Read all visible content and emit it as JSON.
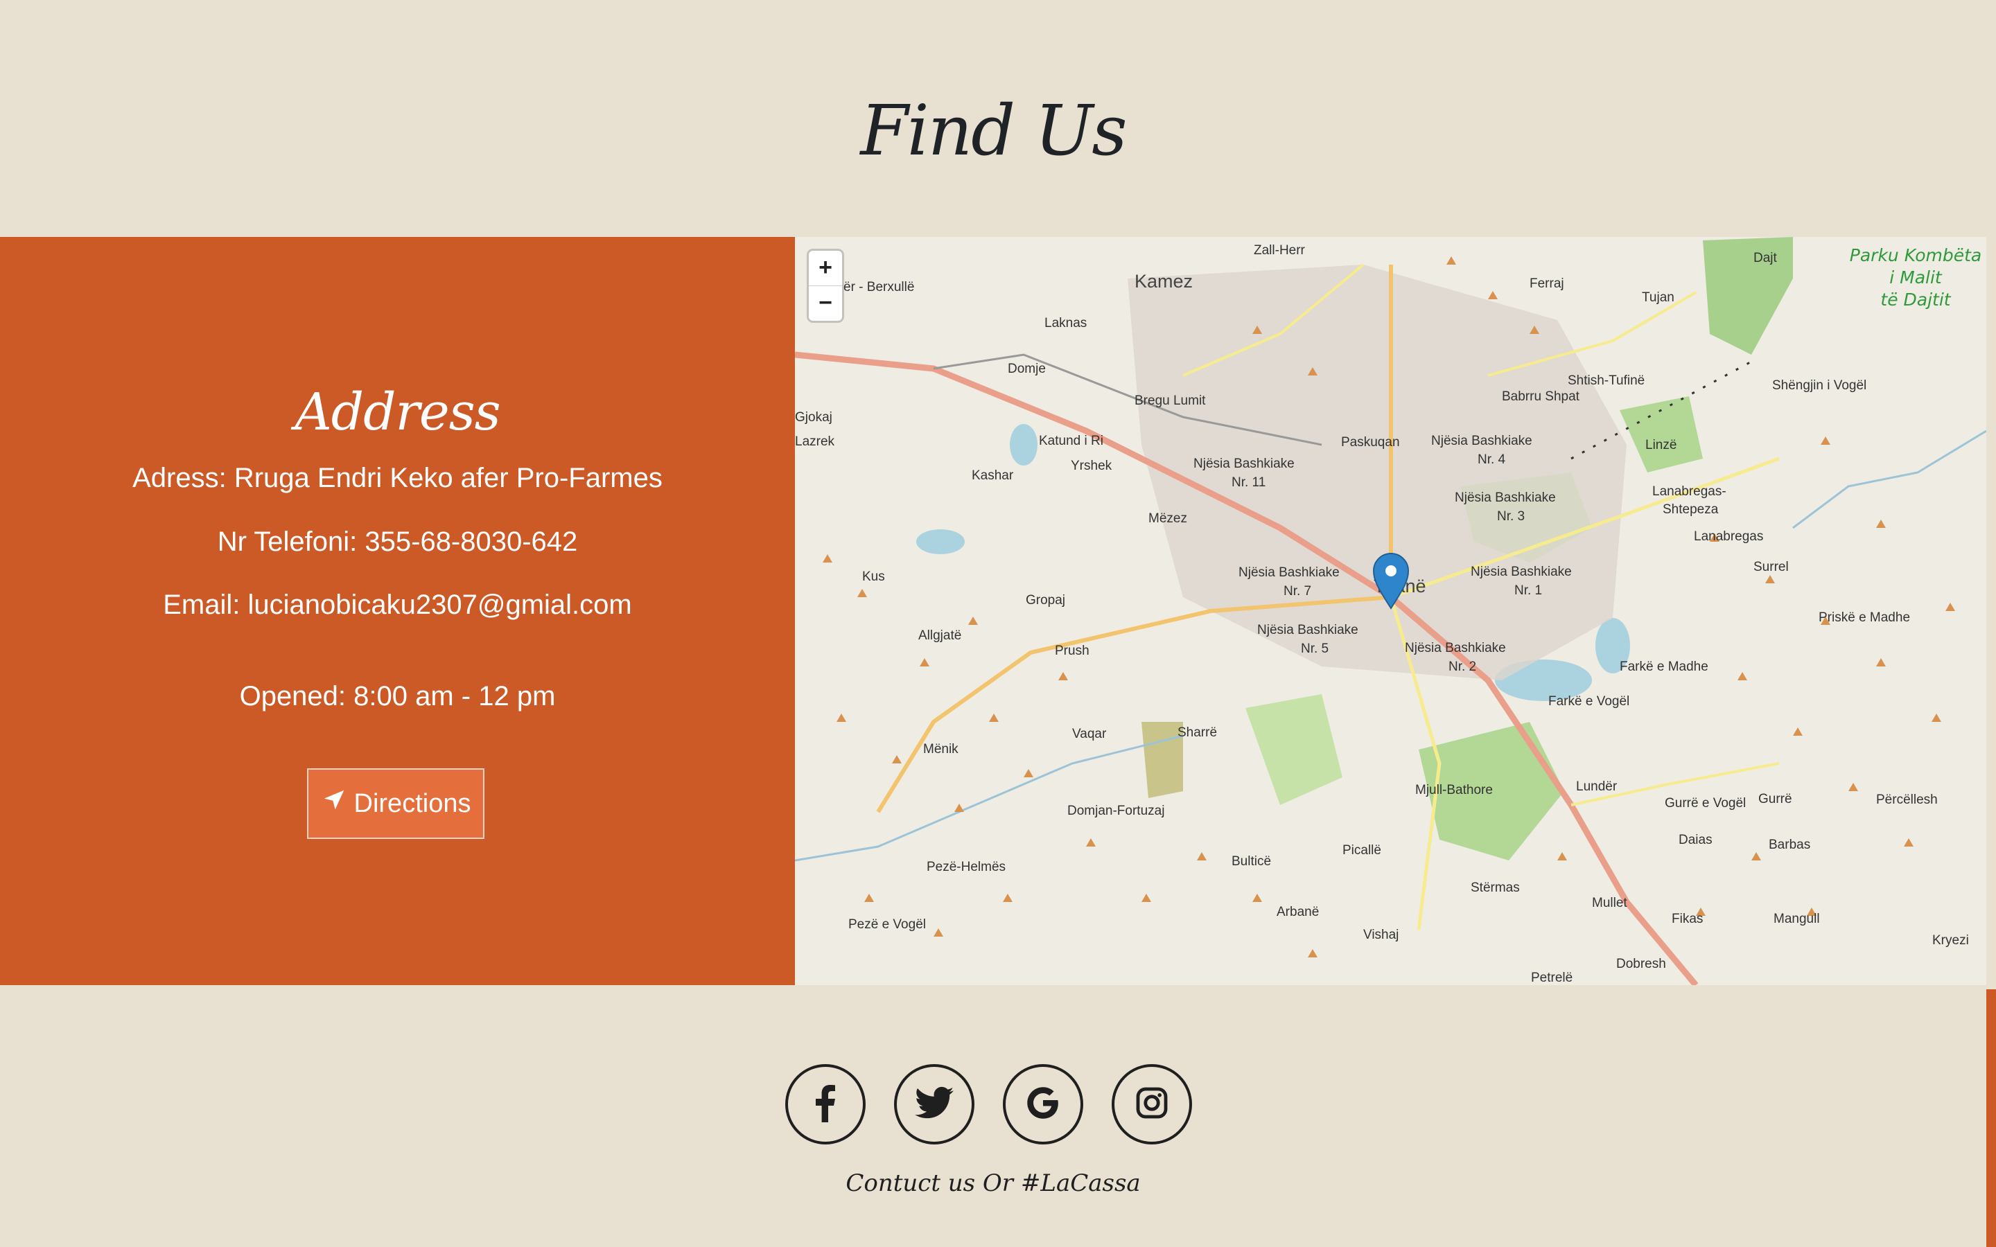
{
  "section_title": "Find Us",
  "address": {
    "heading": "Address",
    "address_line": "Adress: Rruga Endri Keko afer Pro-Farmes",
    "phone_line": "Nr Telefoni: 355-68-8030-642",
    "email_line": "Email: lucianobicaku2307@gmial.com",
    "hours_line": "Opened: 8:00 am - 12 pm",
    "directions_label": "Directions",
    "directions_icon": "location-arrow-icon"
  },
  "map": {
    "zoom_in": "+",
    "zoom_out": "−",
    "marker_icon": "map-pin-icon",
    "park_label": [
      "Parku Kombëta",
      "i Malit",
      "të Dajtit"
    ],
    "labels": [
      "Zall-Herr",
      "Kamez",
      "Ferraj",
      "Tujan",
      "Dajt",
      "Laknas",
      "Bregu Lumit",
      "Domje",
      "Shtish-Tufinë",
      "Shëngjin i Vogël",
      "Babrru Shpat",
      "Paskuqan",
      "Katund i Ri",
      "Yrshek",
      "Njësia Bashkiake Nr. 11",
      "Njësia Bashkiake Nr. 4",
      "Linzë",
      "Kashar",
      "Mëzez",
      "Njësia Bashkiake Nr. 3",
      "Lanabregas-Shtepeza",
      "Lanabregas",
      "Kus",
      "Gropaj",
      "Njësia Bashkiake Nr. 7",
      "Tiranë",
      "Njësia Bashkiake Nr. 1",
      "Surrel",
      "Allgjatë",
      "Prush",
      "Njësia Bashkiake Nr. 5",
      "Njësia Bashkiake Nr. 2",
      "Priskë e Madhe",
      "Farkë e Madhe",
      "Farkë e Vogël",
      "Vaqar",
      "Sharrë",
      "Mënik",
      "Domjan-Fortuzaj",
      "Mjull-Bathore",
      "Lundër",
      "Gurrë e Vogël",
      "Gurrë",
      "Përcëllesh",
      "Daias",
      "Barbas",
      "Pezë-Helmës",
      "Bulticë",
      "Picallë",
      "Stërmas",
      "Mullet",
      "Fikas",
      "Mangull",
      "Pezë e Vogël",
      "Arbanë",
      "Vishaj",
      "Dobresh",
      "Kryezi",
      "Petrelë",
      "Gjokaj",
      "Lazrek",
      "Berxullë"
    ]
  },
  "socials": [
    {
      "name": "facebook-icon"
    },
    {
      "name": "twitter-icon"
    },
    {
      "name": "google-icon"
    },
    {
      "name": "instagram-icon"
    }
  ],
  "footer_text": "Contuct us Or #LaCassa",
  "colors": {
    "page_bg": "#e8e0d0",
    "panel_bg": "#cc5a27",
    "button_bg": "#e56f3c",
    "text_dark": "#1f2328",
    "marker": "#2f85cc"
  }
}
